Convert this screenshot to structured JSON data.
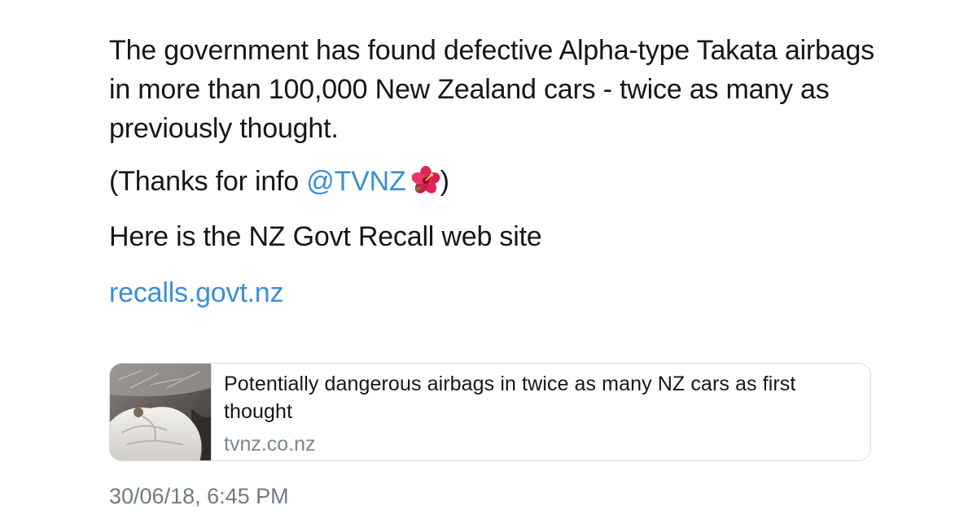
{
  "tweet": {
    "paragraph_1": "The government has found defective Alpha-type Takata airbags in more than 100,000 New Zealand cars - twice as many as previously thought.",
    "paragraph_2_prefix": "(Thanks for info ",
    "paragraph_2_mention": "@TVNZ",
    "paragraph_2_emoji": "hibiscus-icon",
    "paragraph_2_suffix": ")",
    "paragraph_3": "Here is the NZ Govt Recall web site",
    "link_text": "recalls.govt.nz"
  },
  "card": {
    "title": "Potentially dangerous airbags in twice as many NZ cars as first thought",
    "domain": "tvnz.co.nz",
    "thumbnail": "deployed-airbag-thumbnail"
  },
  "timestamp": "30/06/18, 6:45 PM",
  "colors": {
    "link": "#3b8fd4",
    "text": "#14171a",
    "muted": "#6f7b86",
    "border": "#d9dde1"
  }
}
